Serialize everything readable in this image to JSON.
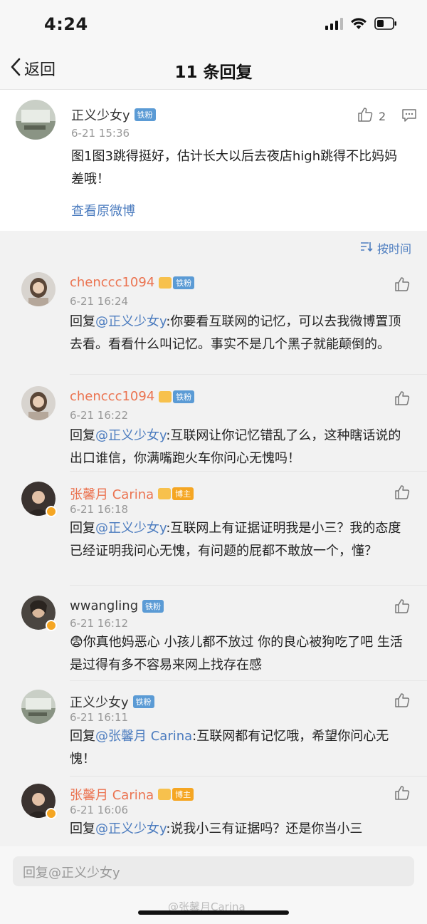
{
  "status_bar": {
    "time": "4:24"
  },
  "nav": {
    "back_label": "返回",
    "title": "11 条回复"
  },
  "root": {
    "user": "正义少女y",
    "badge": "铁粉",
    "time": "6-21 15:36",
    "text": "图1图3跳得挺好，估计长大以后去夜店high跳得不比妈妈差哦！",
    "likes": "2",
    "view_original": "查看原微博"
  },
  "sort": {
    "label": "按时间"
  },
  "replies": [
    {
      "user": "chenccc1094",
      "badge": "铁粉",
      "time": "6-21 16:24",
      "prefix": "回复",
      "mention": "@正义少女y",
      "text": ":你要看互联网的记忆，可以去我微博置顶去看。看看什么叫记忆。事实不是几个黑子就能颠倒的。"
    },
    {
      "user": "chenccc1094",
      "badge": "铁粉",
      "time": "6-21 16:22",
      "prefix": "回复",
      "mention": "@正义少女y",
      "text": ":互联网让你记忆错乱了么，这种瞎话说的出口谁信，你满嘴跑火车你问心无愧吗！"
    },
    {
      "user": "张馨月 Carina",
      "badge": "博主",
      "time": "6-21 16:18",
      "prefix": "回复",
      "mention": "@正义少女y",
      "text": ":互联网上有证据证明我是小三？我的态度已经证明我问心无愧，有问题的屁都不敢放一个，懂？"
    },
    {
      "user": "wwangling",
      "badge": "铁粉",
      "time": "6-21 16:12",
      "prefix": "",
      "mention": "",
      "text": "😨你真他妈恶心 小孩儿都不放过 你的良心被狗吃了吧 生活是过得有多不容易来网上找存在感"
    },
    {
      "user": "正义少女y",
      "badge": "铁粉",
      "time": "6-21 16:11",
      "prefix": "回复",
      "mention": "@张馨月 Carina",
      "text": ":互联网都有记忆哦，希望你问心无愧！"
    },
    {
      "user": "张馨月 Carina",
      "badge": "博主",
      "time": "6-21 16:06",
      "prefix": "回复",
      "mention": "@正义少女y",
      "text": ":说我小三有证据吗？还是你当小三"
    }
  ],
  "input": {
    "placeholder": "回复@正义少女y"
  },
  "watermark": "@张馨月Carina",
  "colors": {
    "link": "#4c7cbf",
    "orange_name": "#eb7350",
    "fan_badge": "#5b9bd5",
    "host_badge": "#f5a623"
  }
}
